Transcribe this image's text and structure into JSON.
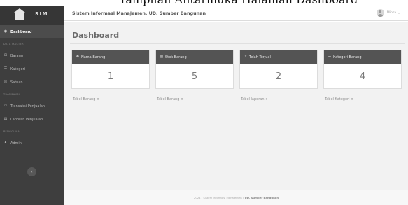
{
  "caption": "Tampilan Antarmuka Halaman Dashboard",
  "brand": {
    "logo_icon": "building-icon",
    "name": "SIM"
  },
  "topbar": {
    "app_title": "Sistem Informasi Manajemen, UD. Sumber Bangunan",
    "user_name": "Minsa",
    "caret": "▾"
  },
  "sidebar": {
    "items": [
      {
        "label": "Dashboard",
        "icon": "dashboard-icon",
        "glyph": "◉",
        "active": true
      },
      {
        "type": "heading",
        "label": "DATA MASTER"
      },
      {
        "label": "Barang",
        "icon": "cube-icon",
        "glyph": "⊞"
      },
      {
        "label": "Kategori",
        "icon": "list-icon",
        "glyph": "☰"
      },
      {
        "label": "Satuan",
        "icon": "scale-icon",
        "glyph": "◎"
      },
      {
        "type": "heading",
        "label": "TRANSAKSI"
      },
      {
        "label": "Transaksi Penjualan",
        "icon": "cart-icon",
        "glyph": "▭"
      },
      {
        "label": "Laporan Penjualan",
        "icon": "report-icon",
        "glyph": "▤"
      },
      {
        "type": "heading",
        "label": "PENGGUNA"
      },
      {
        "label": "Admin",
        "icon": "user-icon",
        "glyph": "♟"
      }
    ],
    "toggle_glyph": "‹"
  },
  "main": {
    "title": "Dashboard",
    "cards": [
      {
        "header": "Nama Barang",
        "icon": "cubes-icon",
        "glyph": "❖",
        "value": "1",
        "link": "Tabel Barang",
        "arrow": "»"
      },
      {
        "header": "Stok Barang",
        "icon": "bar-chart-icon",
        "glyph": "▥",
        "value": "5",
        "link": "Tabel Barang",
        "arrow": "»"
      },
      {
        "header": "Telah Terjual",
        "icon": "upload-icon",
        "glyph": "⇪",
        "value": "2",
        "link": "Tabel laporan",
        "arrow": "»"
      },
      {
        "header": "Kategori Barang",
        "icon": "list-icon",
        "glyph": "☰",
        "value": "4",
        "link": "Tabel Kategori",
        "arrow": "»"
      }
    ]
  },
  "footer": {
    "text": "2024 - Sistem Informasi Manajemen | ",
    "bold": "UD. Sumber Bangunan"
  },
  "colors": {
    "sidebar": "#3e3e3e",
    "card_header": "#545454",
    "content_bg": "#f2f2f2"
  }
}
